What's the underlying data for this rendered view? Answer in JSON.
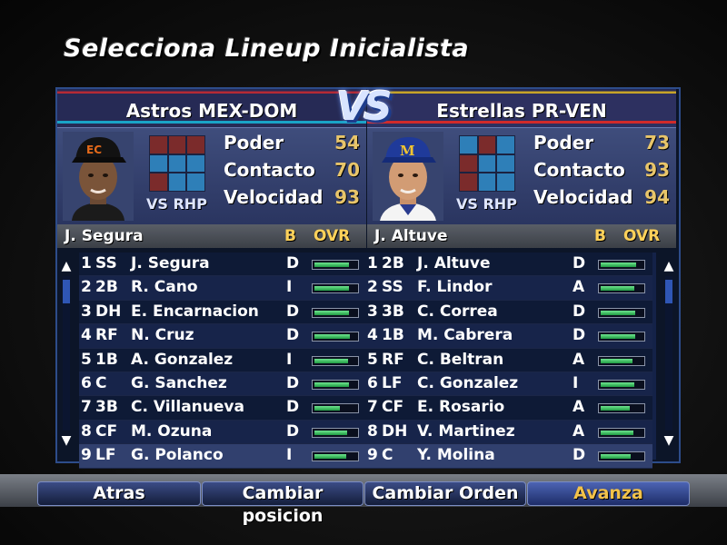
{
  "screen_title": "Selecciona Lineup Inicialista",
  "vs_label": "VS",
  "colors": {
    "accent_gold": "#e8c56a",
    "ovr_bar_green": "#2fbf5a",
    "frame_blue": "#2d4c8a"
  },
  "home_team": {
    "name": "Astros MEX-DOM",
    "cap_logo": "EC",
    "vs_hand": "VS RHP",
    "stats": [
      {
        "label": "Poder",
        "value": "54"
      },
      {
        "label": "Contacto",
        "value": "70"
      },
      {
        "label": "Velocidad",
        "value": "93"
      }
    ],
    "selected_player": "J. Segura",
    "header_b": "B",
    "header_ovr": "OVR",
    "lineup": [
      {
        "order": "1",
        "pos": "SS",
        "name": "J. Segura",
        "bats": "D",
        "ovr": 0.82
      },
      {
        "order": "2",
        "pos": "2B",
        "name": "R. Cano",
        "bats": "I",
        "ovr": 0.82
      },
      {
        "order": "3",
        "pos": "DH",
        "name": "E. Encarnacion",
        "bats": "D",
        "ovr": 0.82
      },
      {
        "order": "4",
        "pos": "RF",
        "name": "N. Cruz",
        "bats": "D",
        "ovr": 0.84
      },
      {
        "order": "5",
        "pos": "1B",
        "name": "A. Gonzalez",
        "bats": "I",
        "ovr": 0.8
      },
      {
        "order": "6",
        "pos": "C",
        "name": "G. Sanchez",
        "bats": "D",
        "ovr": 0.82
      },
      {
        "order": "7",
        "pos": "3B",
        "name": "C. Villanueva",
        "bats": "D",
        "ovr": 0.6
      },
      {
        "order": "8",
        "pos": "CF",
        "name": "M. Ozuna",
        "bats": "D",
        "ovr": 0.78
      },
      {
        "order": "9",
        "pos": "LF",
        "name": "G. Polanco",
        "bats": "I",
        "ovr": 0.75
      }
    ]
  },
  "away_team": {
    "name": "Estrellas PR-VEN",
    "cap_logo": "M",
    "vs_hand": "VS RHP",
    "stats": [
      {
        "label": "Poder",
        "value": "73"
      },
      {
        "label": "Contacto",
        "value": "93"
      },
      {
        "label": "Velocidad",
        "value": "94"
      }
    ],
    "selected_player": "J. Altuve",
    "header_b": "B",
    "header_ovr": "OVR",
    "lineup": [
      {
        "order": "1",
        "pos": "2B",
        "name": "J. Altuve",
        "bats": "D",
        "ovr": 0.85
      },
      {
        "order": "2",
        "pos": "SS",
        "name": "F. Lindor",
        "bats": "A",
        "ovr": 0.8
      },
      {
        "order": "3",
        "pos": "3B",
        "name": "C. Correa",
        "bats": "D",
        "ovr": 0.82
      },
      {
        "order": "4",
        "pos": "1B",
        "name": "M. Cabrera",
        "bats": "D",
        "ovr": 0.82
      },
      {
        "order": "5",
        "pos": "RF",
        "name": "C. Beltran",
        "bats": "A",
        "ovr": 0.75
      },
      {
        "order": "6",
        "pos": "LF",
        "name": "C. Gonzalez",
        "bats": "I",
        "ovr": 0.8
      },
      {
        "order": "7",
        "pos": "CF",
        "name": "E. Rosario",
        "bats": "A",
        "ovr": 0.7
      },
      {
        "order": "8",
        "pos": "DH",
        "name": "V. Martinez",
        "bats": "A",
        "ovr": 0.78
      },
      {
        "order": "9",
        "pos": "C",
        "name": "Y. Molina",
        "bats": "D",
        "ovr": 0.72
      }
    ]
  },
  "buttons": [
    {
      "label": "Atras"
    },
    {
      "label": "Cambiar posicion"
    },
    {
      "label": "Cambiar Orden"
    },
    {
      "label": "Avanza"
    }
  ]
}
